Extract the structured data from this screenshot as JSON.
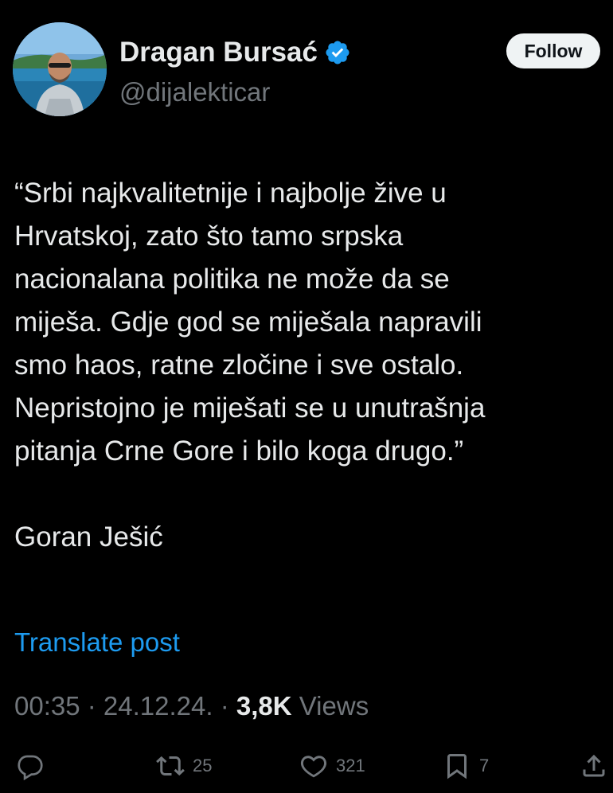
{
  "author": {
    "name": "Dragan Bursać",
    "handle": "@dijalekticar",
    "verified": true
  },
  "follow_label": "Follow",
  "post": {
    "text": "“Srbi najkvalitetnije i najbolje žive u\nHrvatskoj, zato što tamo srpska\nnacionalana politika ne može da se\nmiješa. Gdje god se miješala napravili\nsmo haos, ratne zločine i sve ostalo.\nNepristojno je miješati se u unutrašnja\npitanja Crne Gore i bilo koga drugo.”\n\nGoran Ješić",
    "translate_label": "Translate post"
  },
  "meta": {
    "time": "00:35",
    "date": "24.12.24.",
    "separator": " · ",
    "views_count": "3,8K",
    "views_label": "Views"
  },
  "actions": {
    "reply_icon": "reply-icon",
    "repost_count": "25",
    "like_count": "321",
    "bookmark_count": "7",
    "share_icon": "share-icon"
  },
  "colors": {
    "background": "#000000",
    "text": "#e7e9ea",
    "secondary": "#71767b",
    "link": "#1d9bf0",
    "verified": "#1d9bf0"
  }
}
